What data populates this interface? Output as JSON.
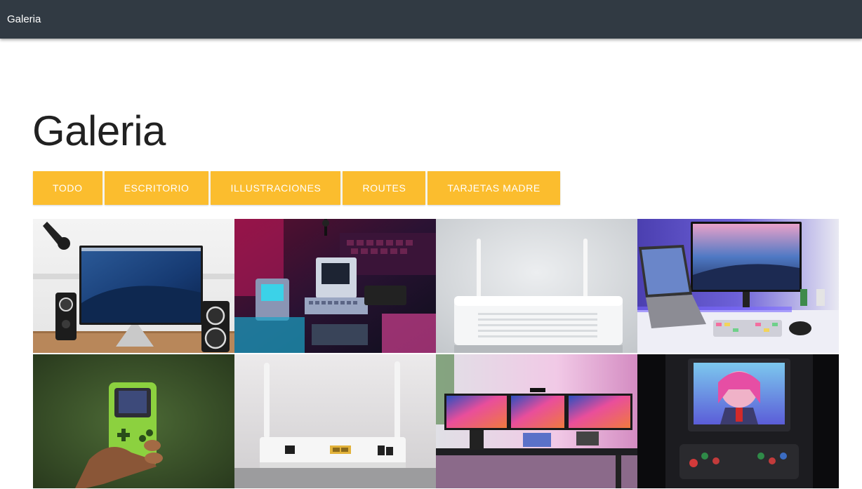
{
  "appbar": {
    "title": "Galeria"
  },
  "page": {
    "heading": "Galeria"
  },
  "filters": [
    {
      "label": "TODO"
    },
    {
      "label": "ESCRITORIO"
    },
    {
      "label": "ILLUSTRACIONES"
    },
    {
      "label": "ROUTES"
    },
    {
      "label": "TARJETAS MADRE"
    }
  ],
  "colors": {
    "appbar": "#313a43",
    "accent": "#fbbd2e"
  },
  "gallery": [
    {
      "subject": "desktop monitor with speakers"
    },
    {
      "subject": "retro computers neon"
    },
    {
      "subject": "white router front"
    },
    {
      "subject": "laptop and monitor desk setup"
    },
    {
      "subject": "green handheld console"
    },
    {
      "subject": "white router back ports"
    },
    {
      "subject": "triple monitor desk setup"
    },
    {
      "subject": "arcade cabinet anime screen"
    }
  ]
}
